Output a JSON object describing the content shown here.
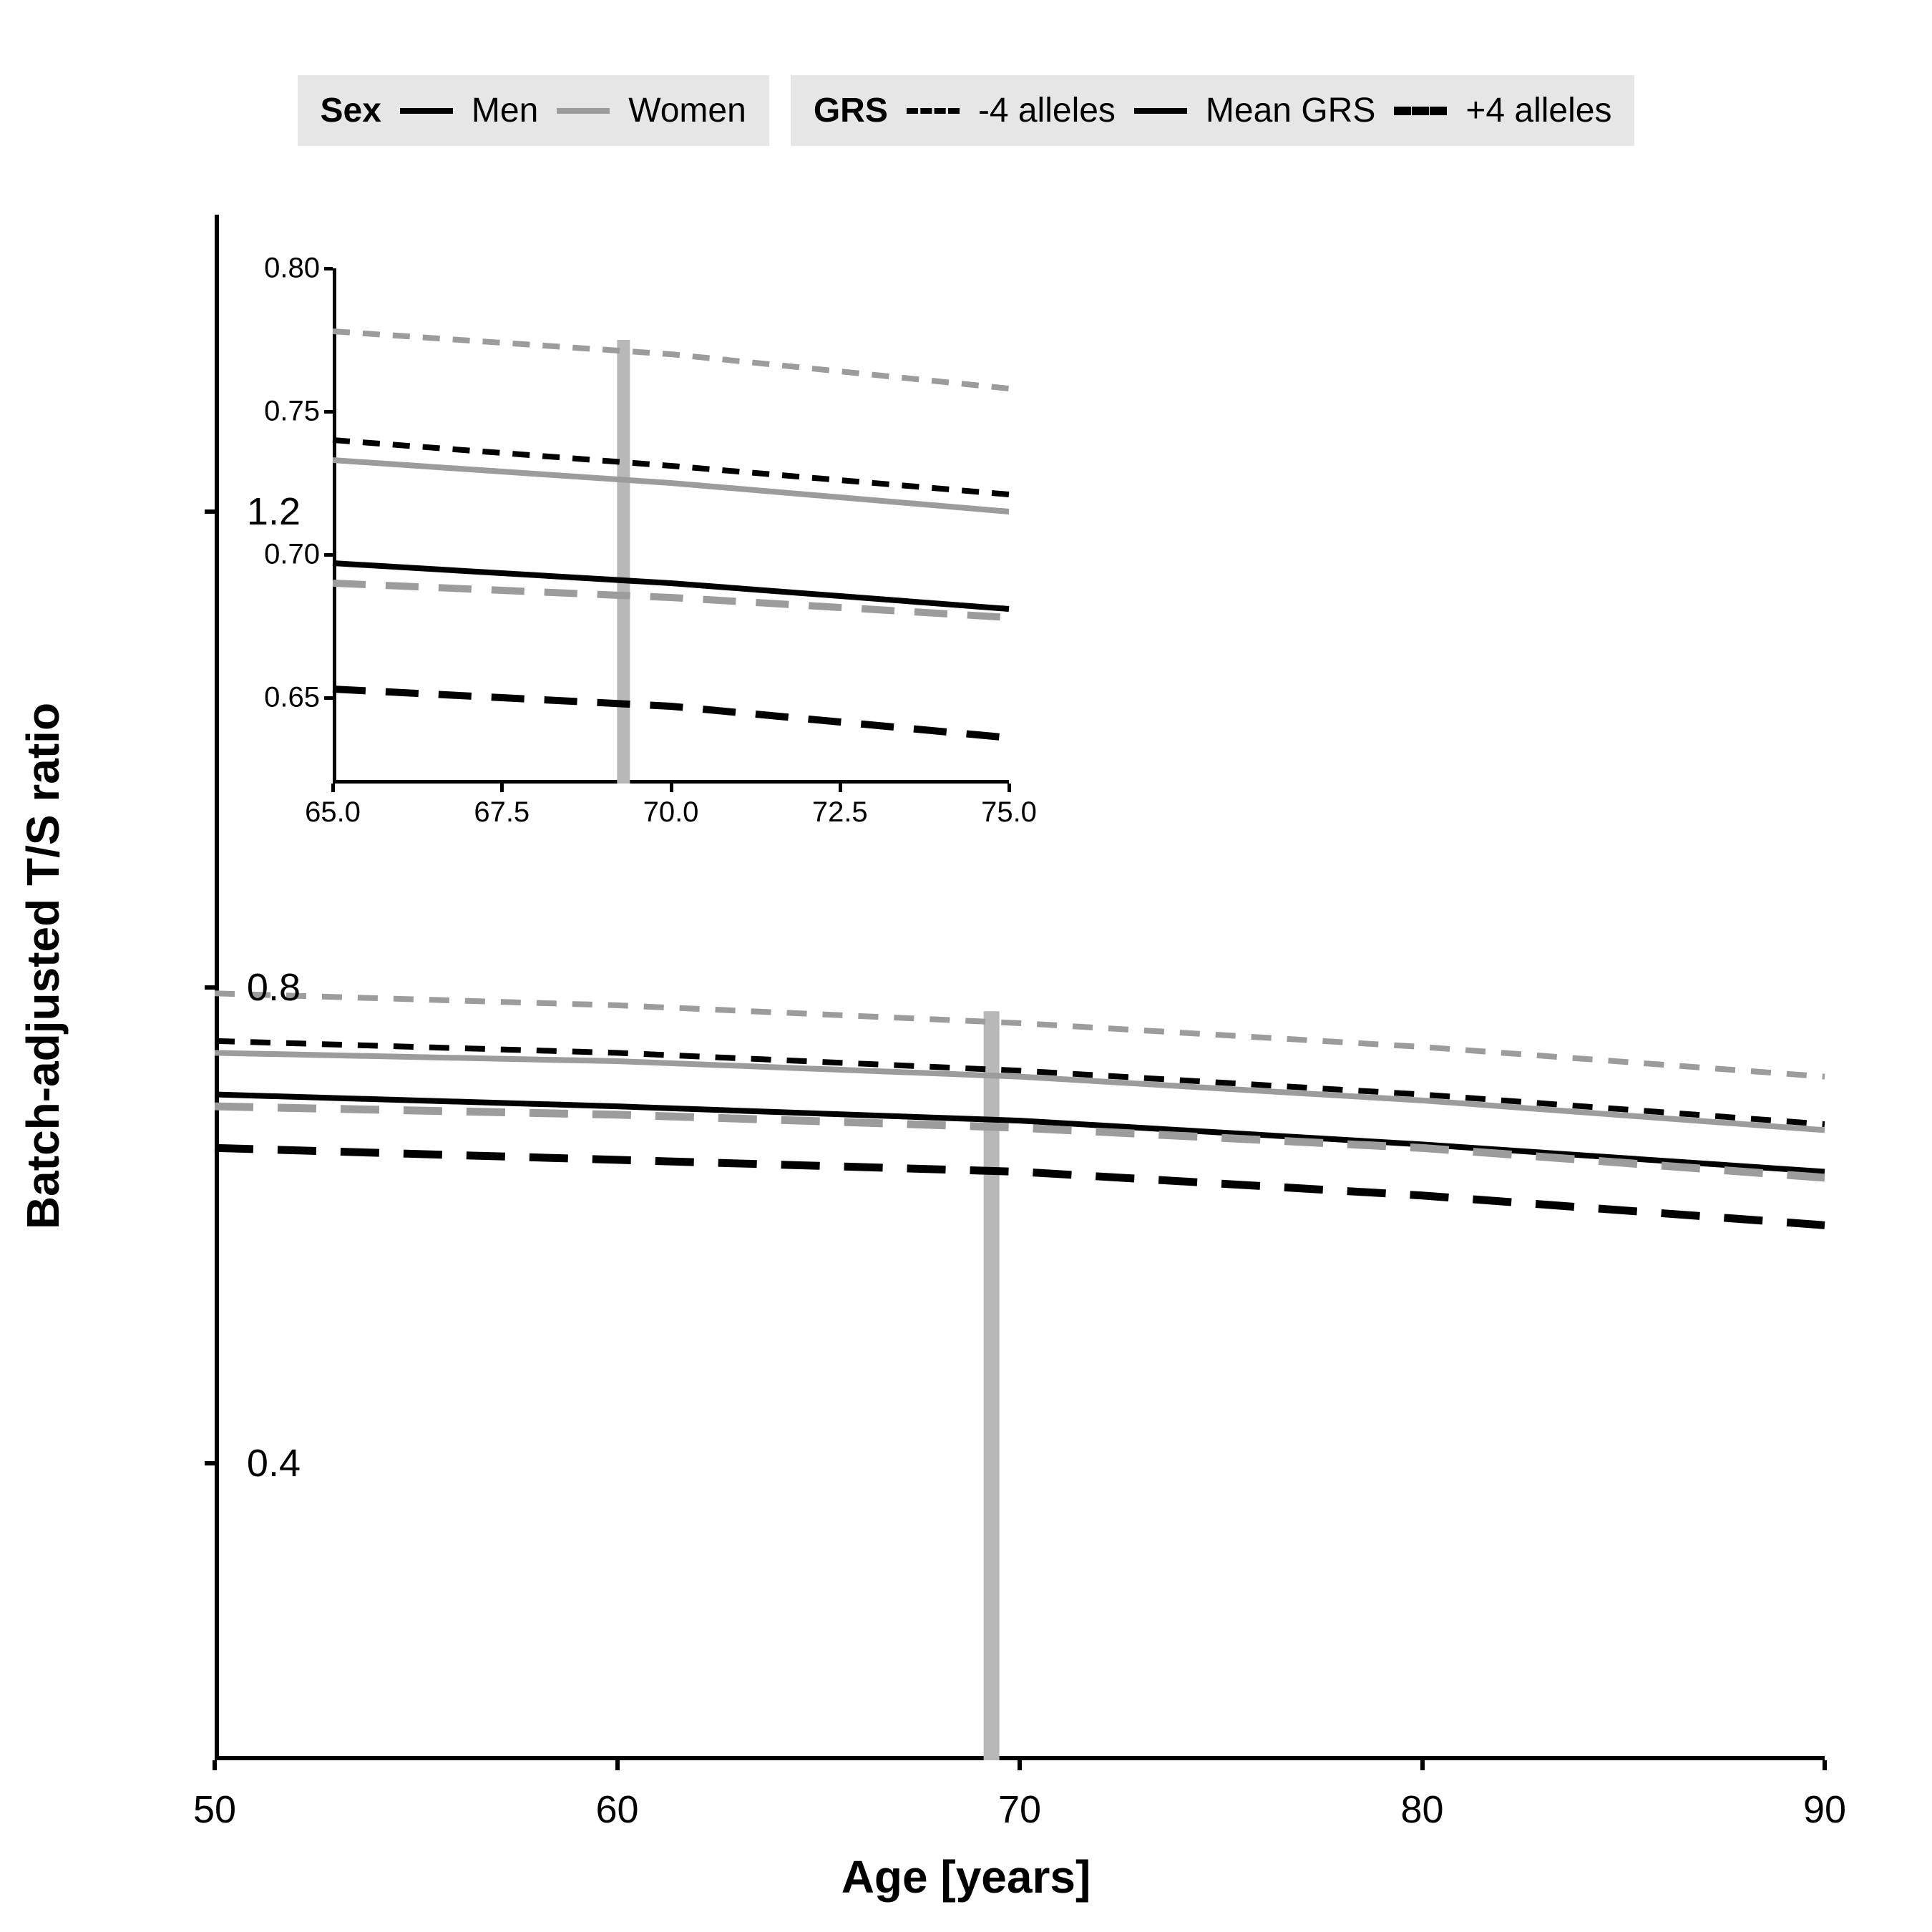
{
  "legend": {
    "sex_title": "Sex",
    "men": "Men",
    "women": "Women",
    "grs_title": "GRS",
    "minus4": "-4 alleles",
    "mean": "Mean GRS",
    "plus4": "+4 alleles"
  },
  "axes": {
    "xlabel": "Age [years]",
    "ylabel": "Batch-adjusted T/S ratio",
    "xticks": [
      "50",
      "60",
      "70",
      "80",
      "90"
    ],
    "yticks": [
      "0.4",
      "0.8",
      "1.2"
    ]
  },
  "inset_axes": {
    "xticks": [
      "65.0",
      "67.5",
      "70.0",
      "72.5",
      "75.0"
    ],
    "yticks": [
      "0.65",
      "0.70",
      "0.75",
      "0.80"
    ]
  },
  "colors": {
    "men": "#000000",
    "women": "#9c9c9c"
  },
  "chart_data": {
    "type": "line",
    "xlabel": "Age [years]",
    "ylabel": "Batch-adjusted T/S ratio",
    "xlim": [
      50,
      90
    ],
    "ylim": [
      0.15,
      1.45
    ],
    "reference_line_x": 69.3,
    "series": [
      {
        "name": "Women +4 alleles",
        "sex": "Women",
        "grs": "+4 alleles",
        "color": "#9c9c9c",
        "linestyle": "short-dash",
        "x": [
          50,
          60,
          70,
          80,
          90
        ],
        "y": [
          0.795,
          0.785,
          0.77,
          0.75,
          0.725
        ]
      },
      {
        "name": "Men +4 alleles",
        "sex": "Men",
        "grs": "+4 alleles",
        "color": "#000000",
        "linestyle": "short-dash",
        "x": [
          50,
          60,
          70,
          80,
          90
        ],
        "y": [
          0.755,
          0.745,
          0.73,
          0.71,
          0.685
        ]
      },
      {
        "name": "Women Mean GRS",
        "sex": "Women",
        "grs": "Mean GRS",
        "color": "#9c9c9c",
        "linestyle": "solid",
        "x": [
          50,
          60,
          70,
          80,
          90
        ],
        "y": [
          0.745,
          0.738,
          0.725,
          0.705,
          0.68
        ]
      },
      {
        "name": "Men Mean GRS",
        "sex": "Men",
        "grs": "Mean GRS",
        "color": "#000000",
        "linestyle": "solid",
        "x": [
          50,
          60,
          70,
          80,
          90
        ],
        "y": [
          0.71,
          0.7,
          0.688,
          0.668,
          0.645
        ]
      },
      {
        "name": "Women -4 alleles",
        "sex": "Women",
        "grs": "-4 alleles",
        "color": "#9c9c9c",
        "linestyle": "long-dash",
        "x": [
          50,
          60,
          70,
          80,
          90
        ],
        "y": [
          0.7,
          0.693,
          0.682,
          0.665,
          0.64
        ]
      },
      {
        "name": "Men -4 alleles",
        "sex": "Men",
        "grs": "-4 alleles",
        "color": "#000000",
        "linestyle": "long-dash",
        "x": [
          50,
          60,
          70,
          80,
          90
        ],
        "y": [
          0.665,
          0.655,
          0.645,
          0.625,
          0.6
        ]
      }
    ],
    "inset": {
      "xlim": [
        65,
        75
      ],
      "ylim": [
        0.62,
        0.8
      ],
      "reference_line_x": 69.3,
      "series": [
        {
          "name": "Women +4 alleles",
          "color": "#9c9c9c",
          "linestyle": "short-dash",
          "x": [
            65,
            70,
            75
          ],
          "y": [
            0.778,
            0.77,
            0.758
          ]
        },
        {
          "name": "Men +4 alleles",
          "color": "#000000",
          "linestyle": "short-dash",
          "x": [
            65,
            70,
            75
          ],
          "y": [
            0.74,
            0.731,
            0.721
          ]
        },
        {
          "name": "Women Mean GRS",
          "color": "#9c9c9c",
          "linestyle": "solid",
          "x": [
            65,
            70,
            75
          ],
          "y": [
            0.733,
            0.725,
            0.715
          ]
        },
        {
          "name": "Men Mean GRS",
          "color": "#000000",
          "linestyle": "solid",
          "x": [
            65,
            70,
            75
          ],
          "y": [
            0.697,
            0.69,
            0.681
          ]
        },
        {
          "name": "Women -4 alleles",
          "color": "#9c9c9c",
          "linestyle": "long-dash",
          "x": [
            65,
            70,
            75
          ],
          "y": [
            0.69,
            0.685,
            0.678
          ]
        },
        {
          "name": "Men -4 alleles",
          "color": "#000000",
          "linestyle": "long-dash",
          "x": [
            65,
            70,
            75
          ],
          "y": [
            0.653,
            0.647,
            0.636
          ]
        }
      ]
    }
  }
}
